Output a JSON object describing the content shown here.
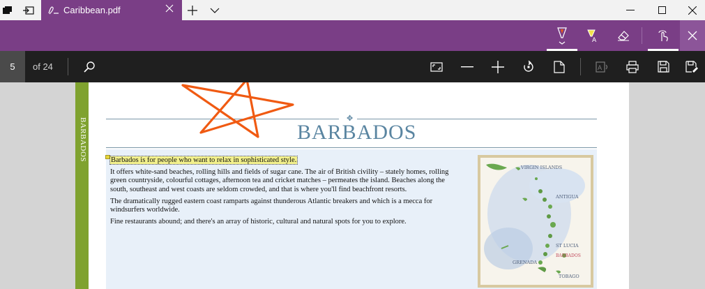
{
  "window": {
    "tab_title": "Caribbean.pdf"
  },
  "reader": {
    "current_page": "5",
    "page_total": "of 24"
  },
  "document": {
    "side_label": "BARBADOS",
    "heading": "BARBADOS",
    "highlighted_sentence": "Barbados is for people who want to relax in sophisticated style.",
    "paragraph_1": "It offers white-sand beaches, rolling hills and fields of sugar cane. The air of British civility – stately homes, rolling green countryside, colourful cottages, afternoon tea and cricket matches – permeates the island. Beaches along the south, southeast and west coasts are seldom crowded, and that is where you'll find beachfront resorts.",
    "paragraph_2": "The dramatically rugged eastern coast ramparts against thunderous Atlantic breakers and which is a mecca for windsurfers worldwide.",
    "paragraph_3": "Fine restaurants abound; and there's an array of historic, cultural and natural spots for you to explore.",
    "map_labels": {
      "virgin_islands": "VIRGIN ISLANDS",
      "antigua": "ANTIGUA",
      "st_lucia": "ST LUCIA",
      "barbados": "BARBADOS",
      "grenada": "GRENADA",
      "tobago": "TOBAGO"
    }
  },
  "colors": {
    "accent": "#7a3e86",
    "toolbar": "#1f1f1f",
    "side_strip": "#7fa22f",
    "heading": "#5a85a1",
    "highlight": "#f2f08c",
    "ink": "#f05a12"
  },
  "icons": [
    "tabs-icon",
    "set-aside-icon",
    "pen-icon",
    "close-icon",
    "plus-icon",
    "chevron-down-icon",
    "minimize-icon",
    "maximize-icon",
    "ballpoint-pen-icon",
    "highlighter-icon",
    "eraser-icon",
    "touch-writing-icon",
    "search-icon",
    "fit-page-icon",
    "zoom-out-icon",
    "zoom-in-icon",
    "rotate-icon",
    "page-view-icon",
    "read-aloud-icon",
    "print-icon",
    "save-icon",
    "save-as-icon"
  ]
}
